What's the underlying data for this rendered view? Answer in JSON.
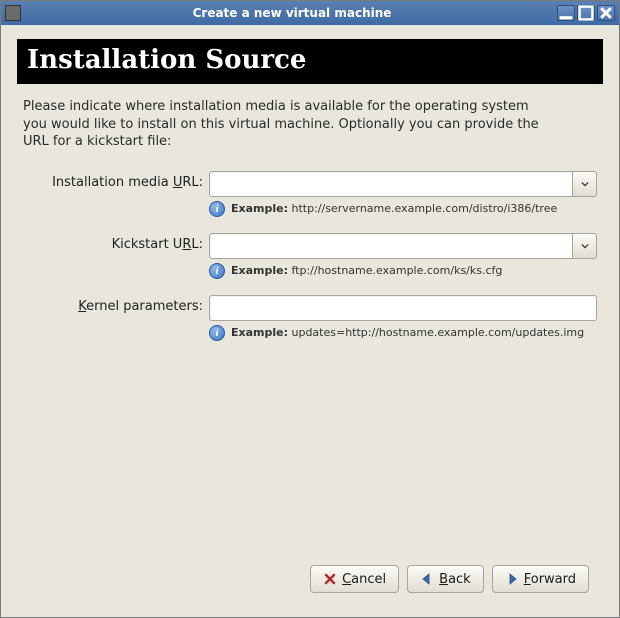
{
  "window": {
    "title": "Create a new virtual machine"
  },
  "header": {
    "title": "Installation Source"
  },
  "intro": "Please indicate where installation media is available for the operating system you would like to install on this virtual machine. Optionally you can provide the URL for a kickstart file:",
  "fields": {
    "media": {
      "label_pre": "Installation media ",
      "label_access": "U",
      "label_post": "RL:",
      "value": "",
      "hint_prefix": "Example:",
      "hint_text": " http://servername.example.com/distro/i386/tree"
    },
    "kickstart": {
      "label_pre": "Kickstart U",
      "label_access": "R",
      "label_post": "L:",
      "value": "",
      "hint_prefix": "Example:",
      "hint_text": " ftp://hostname.example.com/ks/ks.cfg"
    },
    "kernel": {
      "label_pre": "",
      "label_access": "K",
      "label_post": "ernel parameters:",
      "value": "",
      "hint_prefix": "Example:",
      "hint_text": " updates=http://hostname.example.com/updates.img"
    }
  },
  "buttons": {
    "cancel_access": "C",
    "cancel_rest": "ancel",
    "back_access": "B",
    "back_rest": "ack",
    "forward_access": "F",
    "forward_rest": "orward"
  }
}
